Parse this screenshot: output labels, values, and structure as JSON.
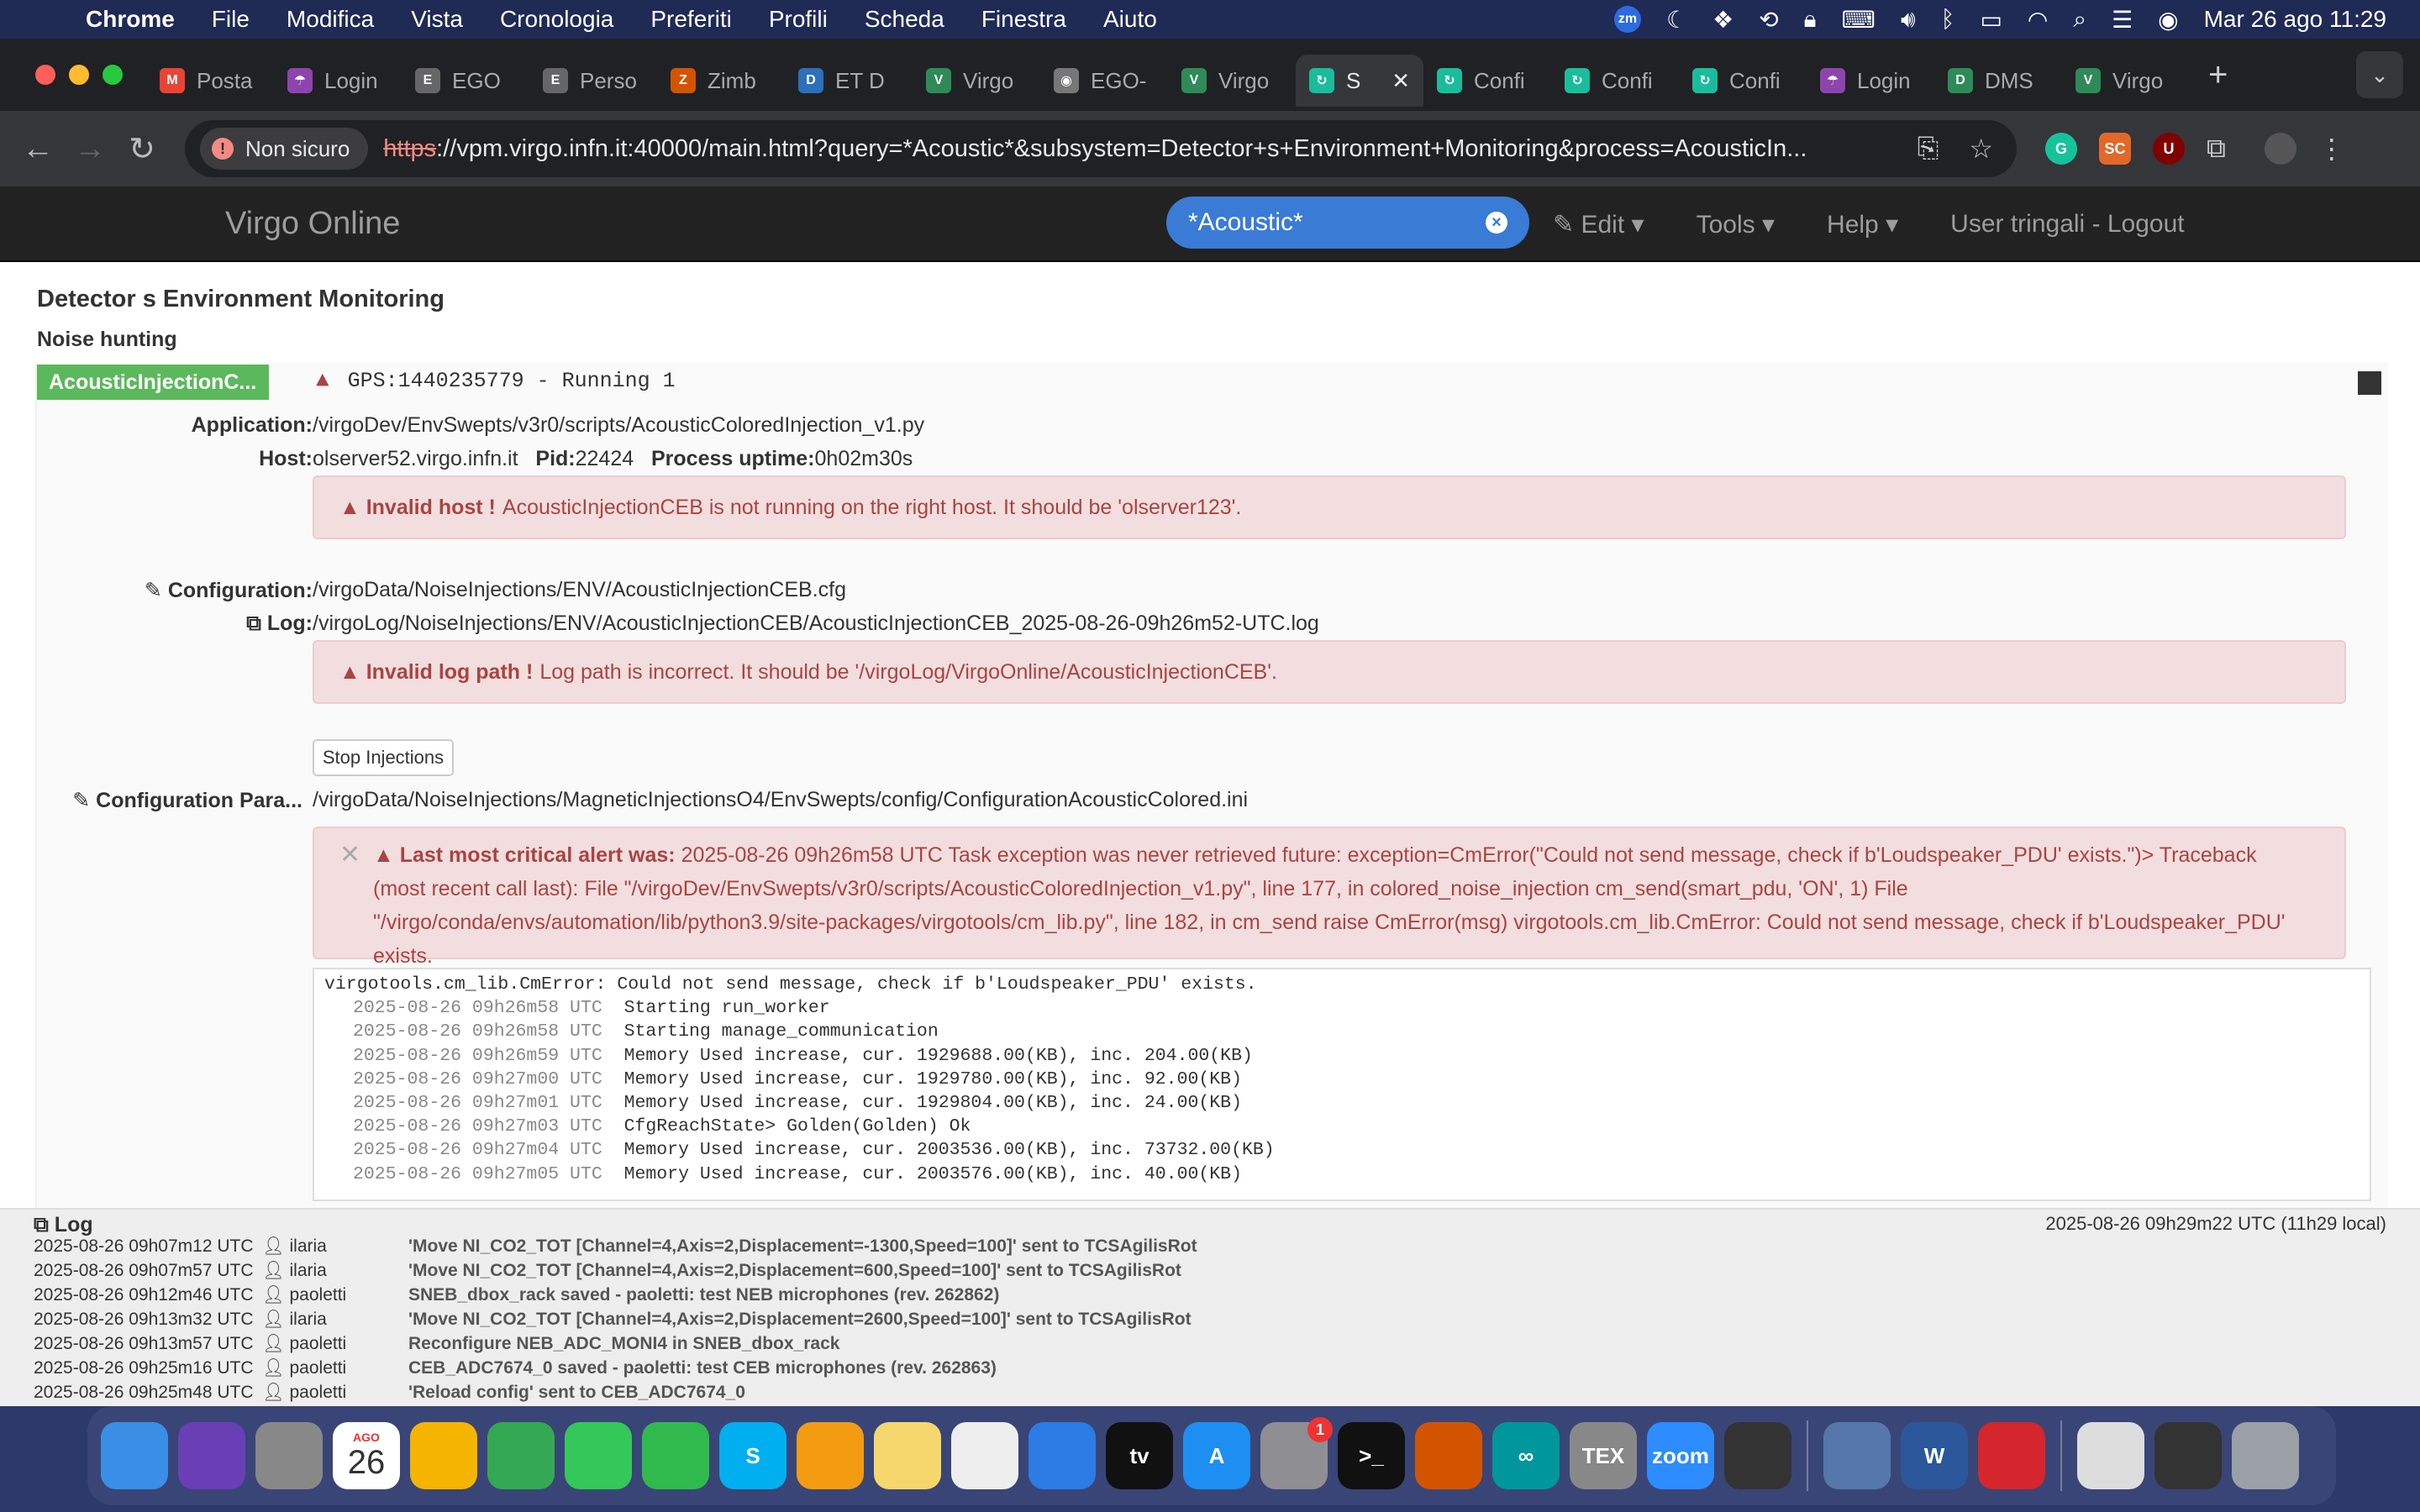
{
  "menubar": {
    "app": "Chrome",
    "items": [
      "File",
      "Modifica",
      "Vista",
      "Cronologia",
      "Preferiti",
      "Profili",
      "Scheda",
      "Finestra",
      "Aiuto"
    ],
    "clock": "Mar 26 ago  11:29",
    "zoom_badge": "zm"
  },
  "tabs": [
    {
      "label": "Posta",
      "color": "#ea4335",
      "icon": "M"
    },
    {
      "label": "Login",
      "color": "#8e44ad",
      "icon": "☂"
    },
    {
      "label": "EGO",
      "color": "#666666",
      "icon": "E"
    },
    {
      "label": "Perso",
      "color": "#666666",
      "icon": "E"
    },
    {
      "label": "Zimb",
      "color": "#d35400",
      "icon": "Z"
    },
    {
      "label": "ET D",
      "color": "#2c6fbb",
      "icon": "D"
    },
    {
      "label": "Virgo",
      "color": "#2e8b57",
      "icon": "V"
    },
    {
      "label": "EGO-",
      "color": "#777777",
      "icon": "◉"
    },
    {
      "label": "Virgo",
      "color": "#2e8b57",
      "icon": "V"
    },
    {
      "label": "S",
      "color": "#1abc9c",
      "icon": "↻",
      "active": true
    },
    {
      "label": "Confi",
      "color": "#1abc9c",
      "icon": "↻"
    },
    {
      "label": "Confi",
      "color": "#1abc9c",
      "icon": "↻"
    },
    {
      "label": "Confi",
      "color": "#1abc9c",
      "icon": "↻"
    },
    {
      "label": "Login",
      "color": "#8e44ad",
      "icon": "☂"
    },
    {
      "label": "DMS",
      "color": "#2e8b57",
      "icon": "D"
    },
    {
      "label": "Virgo",
      "color": "#2e8b57",
      "icon": "V"
    }
  ],
  "toolbar": {
    "not_secure": "Non sicuro",
    "url_scheme": "https",
    "url_rest": "://vpm.virgo.infn.it:40000/main.html?query=*Acoustic*&subsystem=Detector+s+Environment+Monitoring&process=AcousticIn..."
  },
  "appnav": {
    "brand": "Virgo Online",
    "search_value": "*Acoustic*",
    "edit": "Edit",
    "tools": "Tools",
    "help": "Help",
    "user": "User tringali - Logout"
  },
  "main": {
    "section": "Detector s Environment Monitoring",
    "subsection": "Noise hunting",
    "process_name": "AcousticInjectionC...",
    "gps": "GPS:1440235779 - Running 1",
    "application_label": "Application:",
    "application": "/virgoDev/EnvSwepts/v3r0/scripts/AcousticColoredInjection_v1.py",
    "host_label": "Host:",
    "host": "olserver52.virgo.infn.it",
    "pid_label": "Pid:",
    "pid": "22424",
    "uptime_label": "Process uptime:",
    "uptime": "0h02m30s",
    "host_alert_title": "Invalid host !",
    "host_alert_text": "AcousticInjectionCEB is not running on the right host. It should be 'olserver123'.",
    "config_label": "Configuration:",
    "config": "/virgoData/NoiseInjections/ENV/AcousticInjectionCEB.cfg",
    "log_label": "Log:",
    "log": "/virgoLog/NoiseInjections/ENV/AcousticInjectionCEB/AcousticInjectionCEB_2025-08-26-09h26m52-UTC.log",
    "log_alert_title": "Invalid log path !",
    "log_alert_text": "Log path is incorrect. It should be '/virgoLog/VirgoOnline/AcousticInjectionCEB'.",
    "stop_button": "Stop Injections",
    "config_param_label": "Configuration Para...",
    "config_param": "/virgoData/NoiseInjections/MagneticInjectionsO4/EnvSwepts/config/ConfigurationAcousticColored.ini",
    "critical_title": "Last most critical alert was:",
    "critical_text": "2025-08-26 09h26m58 UTC Task exception was never retrieved future: exception=CmError(\"Could not send message, check if b'Loudspeaker_PDU' exists.\")> Traceback (most recent call last): File \"/virgoDev/EnvSwepts/v3r0/scripts/AcousticColoredInjection_v1.py\", line 177, in colored_noise_injection cm_send(smart_pdu, 'ON', 1) File \"/virgo/conda/envs/automation/lib/python3.9/site-packages/virgotools/cm_lib.py\", line 182, in cm_send raise CmError(msg) virgotools.cm_lib.CmError: Could not send message, check if b'Loudspeaker_PDU' exists.",
    "console_first": "virgotools.cm_lib.CmError: Could not send message, check if b'Loudspeaker_PDU' exists.",
    "console": [
      {
        "ts": "2025-08-26 09h26m58 UTC",
        "msg": "Starting run_worker"
      },
      {
        "ts": "2025-08-26 09h26m58 UTC",
        "msg": "Starting manage_communication"
      },
      {
        "ts": "2025-08-26 09h26m59 UTC",
        "msg": "Memory Used increase, cur. 1929688.00(KB), inc. 204.00(KB)"
      },
      {
        "ts": "2025-08-26 09h27m00 UTC",
        "msg": "Memory Used increase, cur. 1929780.00(KB), inc. 92.00(KB)"
      },
      {
        "ts": "2025-08-26 09h27m01 UTC",
        "msg": "Memory Used increase, cur. 1929804.00(KB), inc. 24.00(KB)"
      },
      {
        "ts": "2025-08-26 09h27m03 UTC",
        "msg": "CfgReachState> Golden(Golden) Ok"
      },
      {
        "ts": "2025-08-26 09h27m04 UTC",
        "msg": "Memory Used increase, cur. 2003536.00(KB), inc. 73732.00(KB)"
      },
      {
        "ts": "2025-08-26 09h27m05 UTC",
        "msg": "Memory Used increase, cur. 2003576.00(KB), inc. 40.00(KB)"
      }
    ]
  },
  "logpanel": {
    "title": "Log",
    "time": "2025-08-26 09h29m22 UTC (11h29 local)",
    "rows": [
      {
        "t": "2025-08-26 09h07m12 UTC",
        "u": "ilaria",
        "m": "'Move NI_CO2_TOT [Channel=4,Axis=2,Displacement=-1300,Speed=100]' sent to TCSAgilisRot"
      },
      {
        "t": "2025-08-26 09h07m57 UTC",
        "u": "ilaria",
        "m": "'Move NI_CO2_TOT [Channel=4,Axis=2,Displacement=600,Speed=100]' sent to TCSAgilisRot"
      },
      {
        "t": "2025-08-26 09h12m46 UTC",
        "u": "paoletti",
        "m": "SNEB_dbox_rack saved - paoletti: test NEB microphones (rev. 262862)"
      },
      {
        "t": "2025-08-26 09h13m32 UTC",
        "u": "ilaria",
        "m": "'Move NI_CO2_TOT [Channel=4,Axis=2,Displacement=2600,Speed=100]' sent to TCSAgilisRot"
      },
      {
        "t": "2025-08-26 09h13m57 UTC",
        "u": "paoletti",
        "m": "Reconfigure NEB_ADC_MONI4 in SNEB_dbox_rack"
      },
      {
        "t": "2025-08-26 09h25m16 UTC",
        "u": "paoletti",
        "m": "CEB_ADC7674_0 saved - paoletti: test CEB microphones (rev. 262863)"
      },
      {
        "t": "2025-08-26 09h25m48 UTC",
        "u": "paoletti",
        "m": "'Reload config' sent to CEB_ADC7674_0"
      }
    ]
  },
  "dock": [
    {
      "name": "finder",
      "color": "#3a8ee6",
      "label": ""
    },
    {
      "name": "siri",
      "color": "#6a3fb5",
      "label": ""
    },
    {
      "name": "launchpad",
      "color": "#888888",
      "label": ""
    },
    {
      "name": "calendar",
      "color": "#ffffff",
      "label": "26",
      "month": "AGO"
    },
    {
      "name": "photos",
      "color": "#f4b400",
      "label": ""
    },
    {
      "name": "chrome",
      "color": "#34a853",
      "label": ""
    },
    {
      "name": "messages",
      "color": "#34c759",
      "label": ""
    },
    {
      "name": "facetime",
      "color": "#30b94d",
      "label": ""
    },
    {
      "name": "skype",
      "color": "#00aff0",
      "label": "S"
    },
    {
      "name": "pages",
      "color": "#f39c12",
      "label": ""
    },
    {
      "name": "notes",
      "color": "#f5d76e",
      "label": ""
    },
    {
      "name": "freeform",
      "color": "#eeeeee",
      "label": ""
    },
    {
      "name": "keynote",
      "color": "#2d7be5",
      "label": ""
    },
    {
      "name": "apple-tv",
      "color": "#111111",
      "label": "tv"
    },
    {
      "name": "app-store",
      "color": "#1d8ff2",
      "label": "A"
    },
    {
      "name": "settings",
      "color": "#8e8e93",
      "label": "",
      "badge": "1"
    },
    {
      "name": "terminal",
      "color": "#111111",
      "label": ">_"
    },
    {
      "name": "matlab",
      "color": "#d35400",
      "label": ""
    },
    {
      "name": "arduino",
      "color": "#00979c",
      "label": "∞"
    },
    {
      "name": "tex",
      "color": "#888888",
      "label": "TEX"
    },
    {
      "name": "zoom",
      "color": "#2d8cff",
      "label": "zoom"
    },
    {
      "name": "inkscape",
      "color": "#333333",
      "label": ""
    },
    {
      "name": "vpn",
      "color": "#5577aa",
      "label": ""
    },
    {
      "name": "word",
      "color": "#2b579a",
      "label": "W"
    },
    {
      "name": "acrobat",
      "color": "#d4262c",
      "label": ""
    },
    {
      "name": "preview-docs",
      "color": "#dddddd",
      "label": ""
    },
    {
      "name": "screen-window",
      "color": "#333333",
      "label": ""
    },
    {
      "name": "trash",
      "color": "#9aa0a6",
      "label": ""
    }
  ]
}
